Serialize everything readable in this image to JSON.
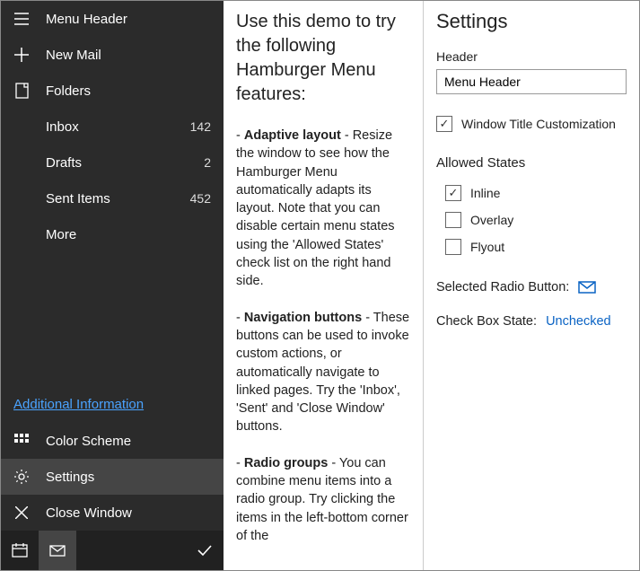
{
  "sidebar": {
    "header": "Menu Header",
    "newMail": "New Mail",
    "folders": "Folders",
    "items": [
      {
        "label": "Inbox",
        "count": "142"
      },
      {
        "label": "Drafts",
        "count": "2"
      },
      {
        "label": "Sent Items",
        "count": "452"
      },
      {
        "label": "More",
        "count": ""
      }
    ],
    "link": "Additional Information",
    "colorScheme": "Color Scheme",
    "settings": "Settings",
    "closeWindow": "Close Window"
  },
  "content": {
    "title": "Use this demo to try the following Hamburger Menu features:",
    "p1a": "- ",
    "p1b": "Adaptive layout",
    "p1c": " - Resize the window to see how the Hamburger Menu automatically adapts its layout. Note that you can disable certain menu states using the 'Allowed States' check list on the right hand side.",
    "p2a": "- ",
    "p2b": "Navigation buttons",
    "p2c": " - These buttons can be used to invoke custom actions, or automatically navigate to linked pages. Try the 'Inbox', 'Sent' and 'Close Window' buttons.",
    "p3a": "- ",
    "p3b": "Radio groups",
    "p3c": " - You can combine menu items into a radio group. Try clicking the items in the left-bottom corner of the"
  },
  "settings": {
    "title": "Settings",
    "headerLabel": "Header",
    "headerValue": "Menu Header",
    "customization": "Window Title Customization",
    "allowedStates": "Allowed States",
    "states": [
      {
        "label": "Inline",
        "checked": true
      },
      {
        "label": "Overlay",
        "checked": false
      },
      {
        "label": "Flyout",
        "checked": false
      }
    ],
    "selectedRadioLabel": "Selected Radio Button:",
    "checkBoxLabel": "Check Box State:",
    "checkBoxValue": "Unchecked"
  }
}
